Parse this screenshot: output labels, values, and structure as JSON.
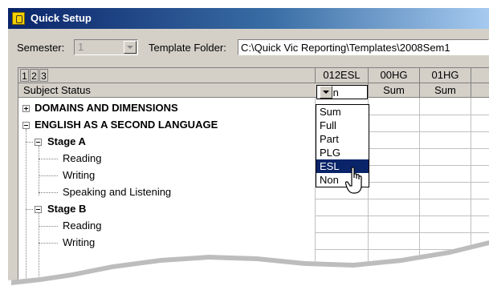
{
  "window": {
    "title": "Quick Setup",
    "icon": "app-icon"
  },
  "toolbar": {
    "semester_label": "Semester:",
    "semester_value": "1",
    "template_label": "Template Folder:",
    "template_value": "C:\\Quick Vic Reporting\\Templates\\2008Sem1"
  },
  "grid": {
    "levels": [
      "1",
      "2",
      "3"
    ],
    "row_header_label": "Subject Status",
    "columns": [
      {
        "name": "012ESL",
        "status": "Non"
      },
      {
        "name": "00HG",
        "status": "Sum"
      },
      {
        "name": "01HG",
        "status": "Sum"
      }
    ],
    "tree": [
      {
        "label": "DOMAINS AND DIMENSIONS",
        "level": 0,
        "expander": "plus"
      },
      {
        "label": "ENGLISH AS A SECOND LANGUAGE",
        "level": 0,
        "expander": "minus"
      },
      {
        "label": "Stage A",
        "level": 1,
        "expander": "minus"
      },
      {
        "label": "Reading",
        "level": 2
      },
      {
        "label": "Writing",
        "level": 2
      },
      {
        "label": "Speaking and Listening",
        "level": 2
      },
      {
        "label": "Stage B",
        "level": 1,
        "expander": "minus"
      },
      {
        "label": "Reading",
        "level": 2
      },
      {
        "label": "Writing",
        "level": 2
      }
    ]
  },
  "dropdown": {
    "options": [
      "Sum",
      "Full",
      "Part",
      "PLG",
      "ESL",
      "Non"
    ],
    "highlighted": "ESL"
  },
  "colors": {
    "title_start": "#0a246a",
    "title_end": "#a6caf0",
    "selection": "#0a246a",
    "face": "#d4d0c8"
  }
}
